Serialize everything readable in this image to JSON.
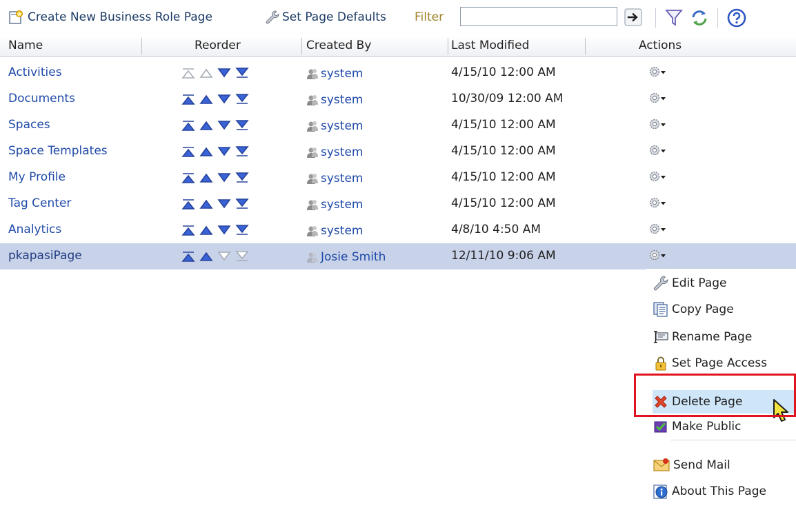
{
  "toolbar": {
    "create_label": "Create New Business Role Page",
    "defaults_label": "Set Page Defaults",
    "filter_label": "Filter",
    "filter_value": "",
    "filter_placeholder": ""
  },
  "table": {
    "columns": [
      "Name",
      "Reorder",
      "Created By",
      "Last Modified",
      "Actions"
    ],
    "rows": [
      {
        "name": "Activities",
        "created_by": "system",
        "modified": "4/15/10 12:00 AM"
      },
      {
        "name": "Documents",
        "created_by": "system",
        "modified": "10/30/09 12:00 AM"
      },
      {
        "name": "Spaces",
        "created_by": "system",
        "modified": "4/15/10 12:00 AM"
      },
      {
        "name": "Space Templates",
        "created_by": "system",
        "modified": "4/15/10 12:00 AM"
      },
      {
        "name": "My Profile",
        "created_by": "system",
        "modified": "4/15/10 12:00 AM"
      },
      {
        "name": "Tag Center",
        "created_by": "system",
        "modified": "4/15/10 12:00 AM"
      },
      {
        "name": "Analytics",
        "created_by": "system",
        "modified": "4/8/10 4:50 AM"
      },
      {
        "name": "pkapasiPage",
        "created_by": "Josie Smith",
        "modified": "12/11/10 9:06 AM"
      }
    ]
  },
  "menu": {
    "items": [
      {
        "label": "Edit Page",
        "icon": "wrench-icon"
      },
      {
        "label": "Copy Page",
        "icon": "copy-icon"
      },
      {
        "label": "Rename Page",
        "icon": "rename-icon"
      },
      {
        "label": "Set Page Access",
        "icon": "lock-icon"
      },
      {
        "label": "Delete Page",
        "icon": "delete-x-icon"
      },
      {
        "label": "Make Public",
        "icon": "checkbox-icon"
      },
      {
        "label": "Send Mail",
        "icon": "mail-icon"
      },
      {
        "label": "About This Page",
        "icon": "info-icon"
      }
    ]
  },
  "colors": {
    "link": "#1f4aa8",
    "selected_row": "#c8d2e8",
    "menu_highlight": "#cfe6f9",
    "annotation_box": "#e0141e"
  }
}
